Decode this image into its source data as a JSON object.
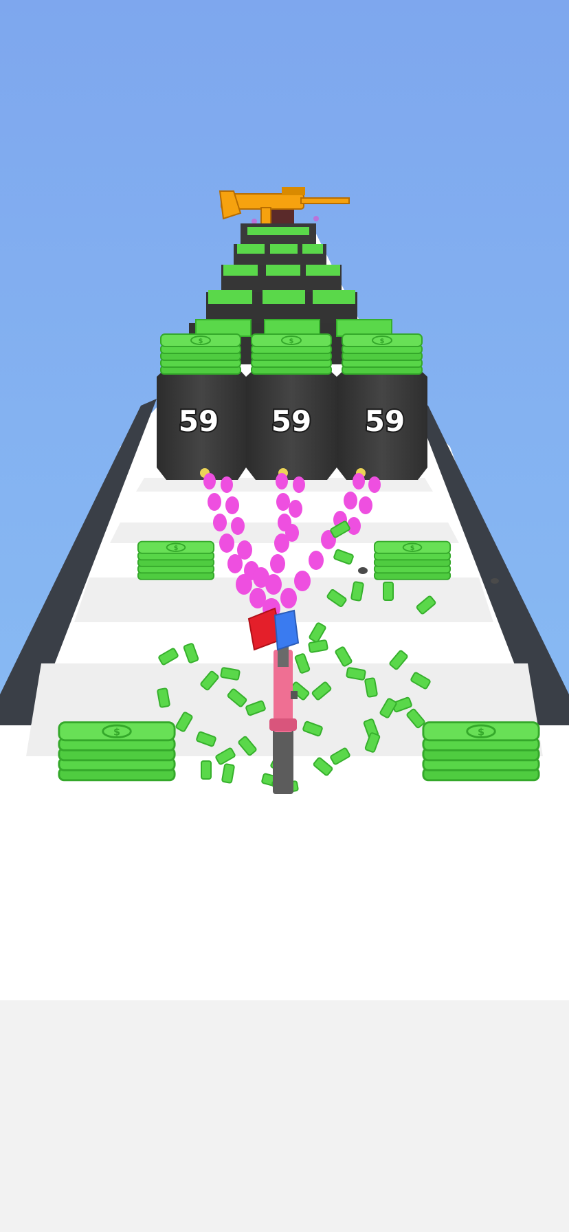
{
  "colors": {
    "sky_top": "#7fa9ef",
    "sky_bottom": "#8ec3f7",
    "track_white": "#ffffff",
    "track_stripe": "#ececec",
    "rail_dark": "#3b4048",
    "ground": "#f2f2f2",
    "block_gray": "#3a3a3a",
    "money_green": "#5ad84a",
    "money_dark": "#36b02c",
    "bullet_pink": "#ee4fe0",
    "gun_orange": "#f6a20f",
    "gun_pink": "#ef6f93",
    "gun_blue": "#3a7bf0",
    "gun_red": "#e41f2a"
  },
  "obstacles": {
    "front_row_values": [
      "59",
      "59",
      "59"
    ]
  },
  "icons": {
    "reward_weapon": "golden-rifle-icon",
    "player_weapon": "pink-pistol-icon",
    "cash": "cash-stack-icon"
  }
}
